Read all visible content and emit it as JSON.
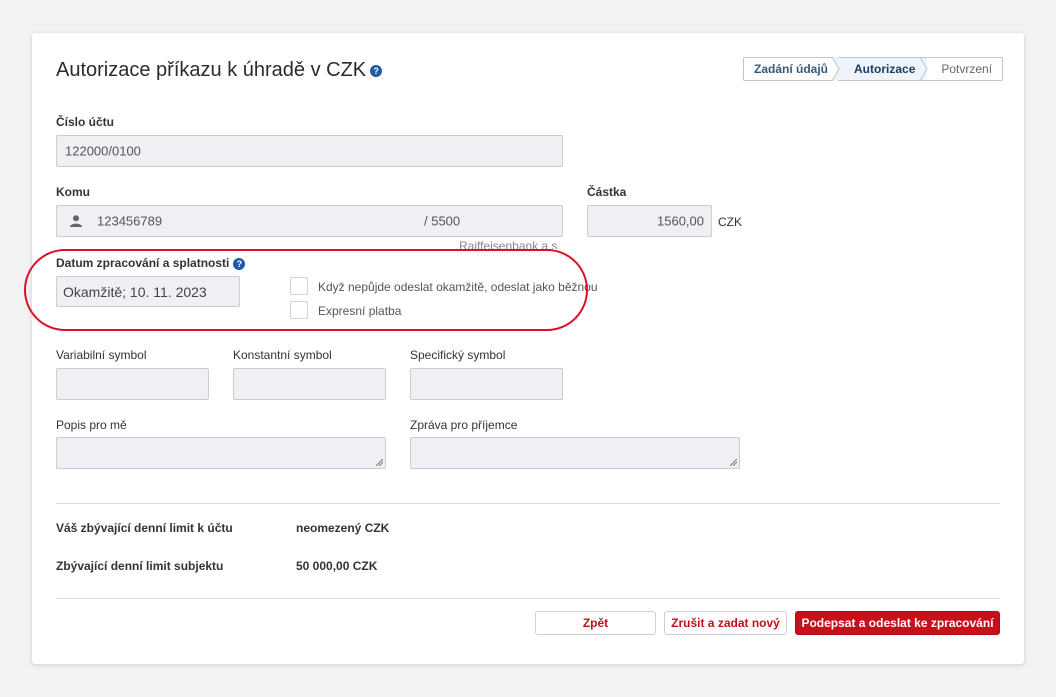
{
  "title": "Autorizace příkazu k úhradě v CZK",
  "stepper": [
    "Zadání údajů",
    "Autorizace",
    "Potvrzení"
  ],
  "account": {
    "label": "Číslo účtu",
    "value": "122000/0100"
  },
  "to": {
    "label": "Komu",
    "account": "123456789",
    "bank_code": "/ 5500",
    "bank_name": "Raiffeisenbank a.s."
  },
  "amount": {
    "label": "Částka",
    "value": "1560,00",
    "currency": "CZK"
  },
  "date": {
    "label": "Datum zpracování a splatnosti",
    "value": "Okamžitě; 10. 11. 2023",
    "option1": "Když nepůjde odeslat okamžitě, odeslat jako běžnou",
    "option2": "Expresní platba"
  },
  "symbols": {
    "variable": "Variabilní symbol",
    "constant": "Konstantní symbol",
    "specific": "Specifický symbol"
  },
  "notes": {
    "self": "Popis pro mě",
    "recipient": "Zpráva pro příjemce"
  },
  "limits": {
    "account_label": "Váš zbývající denní limit k účtu",
    "account_value": "neomezený CZK",
    "subject_label": "Zbývající denní limit subjektu",
    "subject_value": "50 000,00 CZK"
  },
  "buttons": {
    "back": "Zpět",
    "cancel": "Zrušit a zadat nový",
    "sign": "Podepsat a odeslat ke zpracování"
  },
  "colors": {
    "accent": "#c8101c",
    "highlight": "#d8102a",
    "help": "#1e5aa8"
  }
}
